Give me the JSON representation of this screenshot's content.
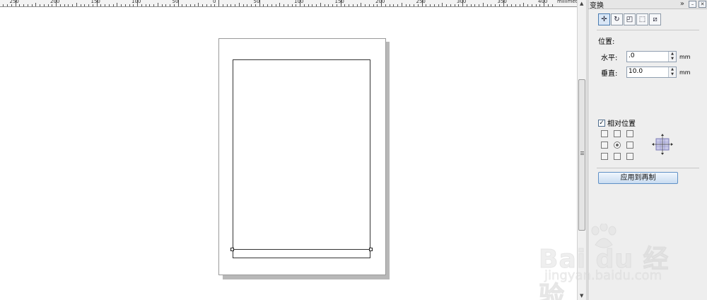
{
  "ruler": {
    "labels": [
      "250",
      "200",
      "150",
      "100",
      "50",
      "0",
      "50",
      "100",
      "150",
      "200",
      "250",
      "300",
      "350",
      "400"
    ],
    "unit": "millimeters"
  },
  "docker": {
    "title": "变换",
    "tools": [
      "position-icon",
      "rotate-icon",
      "scale-icon",
      "size-icon",
      "skew-icon"
    ],
    "position_label": "位置:",
    "horizontal": {
      "label": "水平:",
      "value": ".0",
      "unit": "mm"
    },
    "vertical": {
      "label": "垂直:",
      "value": "10.0",
      "unit": "mm"
    },
    "relative_label": "相对位置",
    "relative_checked": true,
    "apply_label": "应用到再制"
  },
  "watermark": {
    "brand": "Bai du 经验",
    "url": "jingyan.baidu.com"
  },
  "colors": {
    "accent": "#5f90c6",
    "panel_bg": "#eeeeee"
  }
}
